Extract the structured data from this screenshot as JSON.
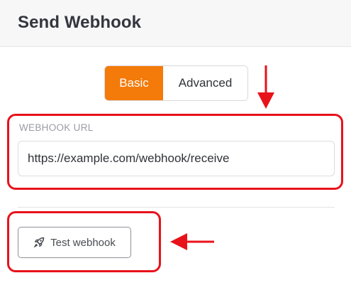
{
  "header": {
    "title": "Send Webhook"
  },
  "mode_toggle": {
    "basic_label": "Basic",
    "advanced_label": "Advanced",
    "selected": "Basic"
  },
  "webhook_url": {
    "label": "WEBHOOK URL",
    "value": "https://example.com/webhook/receive"
  },
  "test_button": {
    "label": "Test webhook",
    "icon": "rocket-icon"
  },
  "annotations": {
    "highlight_color": "#e8121b",
    "accent_color": "#f47a0a"
  }
}
